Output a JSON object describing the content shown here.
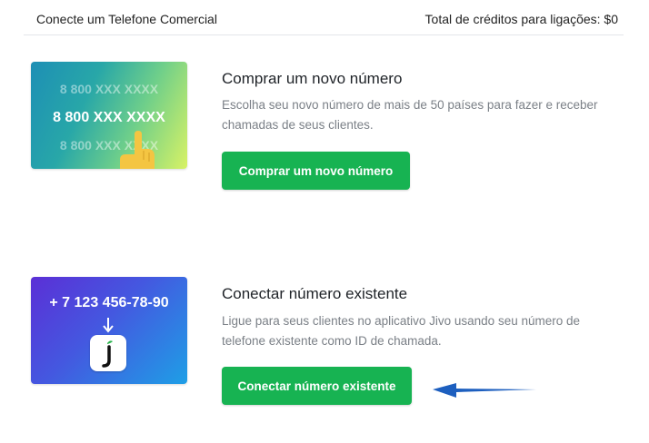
{
  "header": {
    "title": "Conecte um Telefone Comercial",
    "credits": "Total de créditos para ligações: $0"
  },
  "options": [
    {
      "illustration": {
        "numbers": [
          "8 800 XXX XXXX",
          "8 800 XXX XXXX",
          "8 800 XXX XXXX"
        ],
        "icon": "pointing-hand-icon"
      },
      "title": "Comprar um novo número",
      "description": "Escolha seu novo número de mais de 50 países para fazer e receber chamadas de seus clientes.",
      "button_label": "Comprar um novo número"
    },
    {
      "illustration": {
        "phone": "+ 7 123 456-78-90",
        "icon": "jivo-logo-icon"
      },
      "title": "Conectar número existente",
      "description": "Ligue para seus clientes no aplicativo Jivo usando seu número de telefone existente como ID de chamada.",
      "button_label": "Conectar número existente"
    }
  ],
  "colors": {
    "button_green": "#17b352",
    "arrow_blue": "#1d5fbf"
  }
}
